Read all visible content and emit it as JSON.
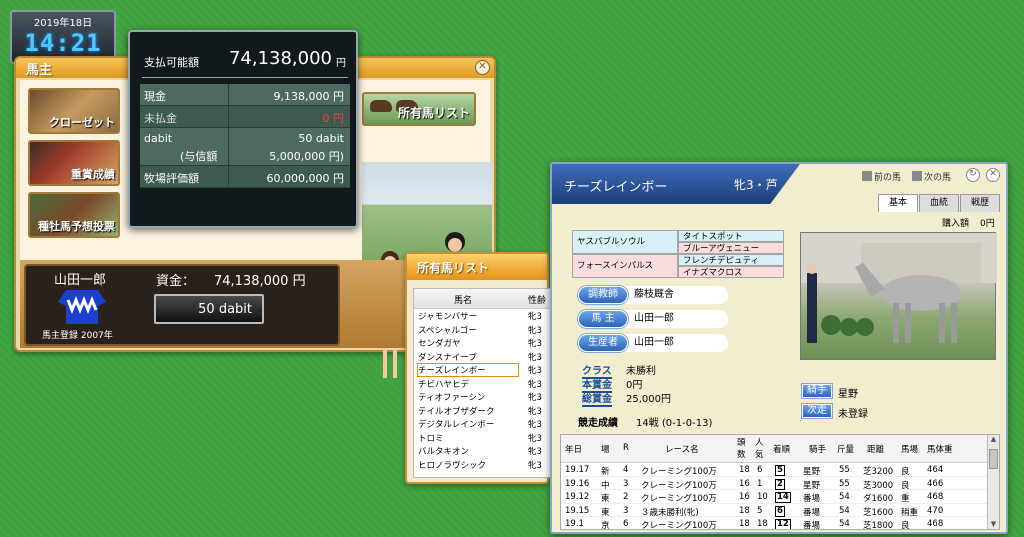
{
  "clock": {
    "date": "2019年18日",
    "time": "14:21"
  },
  "owner_window": {
    "title": "馬主",
    "menu": [
      {
        "label": "クローゼット"
      },
      {
        "label": "重賞成績"
      },
      {
        "label": "種牡馬予想投票"
      }
    ],
    "horse_list_button": "所有馬リスト",
    "owner_name": "山田一郎",
    "registration": "馬主登録 2007年",
    "funds_label": "資金：",
    "funds_value": "74,138,000 円",
    "dabit_button": "50 dabit"
  },
  "payment_popup": {
    "available_label": "支払可能額",
    "available_value": "74,138,000",
    "unit": "円",
    "rows": [
      {
        "key": "現金",
        "value": "9,138,000 円"
      },
      {
        "key": "未払金",
        "value": "0 円"
      },
      {
        "key": "dabit",
        "value": "50 dabit",
        "sub_key": "(与信額",
        "sub_value": "5,000,000 円)"
      },
      {
        "key": "牧場評価額",
        "value": "60,000,000 円"
      }
    ]
  },
  "horse_list": {
    "title": "所有馬リスト",
    "columns": [
      "馬名",
      "性齢"
    ],
    "items": [
      {
        "name": "ジャモンバサー",
        "sex": "牝3"
      },
      {
        "name": "スペシャルゴー",
        "sex": "牝3"
      },
      {
        "name": "センダガヤ",
        "sex": "牝3"
      },
      {
        "name": "ダンスナイーブ",
        "sex": "牝3"
      },
      {
        "name": "チーズレインボー",
        "sex": "牝3"
      },
      {
        "name": "チビハヤヒデ",
        "sex": "牝3"
      },
      {
        "name": "ティオファーシン",
        "sex": "牝3"
      },
      {
        "name": "テイルオブザダーク",
        "sex": "牝3"
      },
      {
        "name": "デジタルレインボー",
        "sex": "牝3"
      },
      {
        "name": "トロミ",
        "sex": "牝3"
      },
      {
        "name": "バルタキオン",
        "sex": "牝3"
      },
      {
        "name": "ヒロノラヴシック",
        "sex": "牝3"
      }
    ],
    "selected": "チーズレインボー"
  },
  "horse_detail": {
    "name": "チーズレインボー",
    "sex_age": "牝3・芦",
    "prev_label": "前の馬",
    "next_label": "次の馬",
    "tabs": [
      "基本",
      "血統",
      "戦歴"
    ],
    "purchase_label": "購入額",
    "purchase_value": "0円",
    "pedigree": {
      "sire": "ヤスパブルソウル",
      "dam": "フォースインパルス",
      "sire_sire": "タイトスポット",
      "sire_dam": "ブルーアヴェニュー",
      "dam_sire": "フレンチデピュティ",
      "dam_dam": "イナズマクロス"
    },
    "info": [
      {
        "label": "調教師",
        "value": "藤枝厩舎"
      },
      {
        "label": "馬 主",
        "value": "山田一郎"
      },
      {
        "label": "生産者",
        "value": "山田一郎"
      }
    ],
    "class_label": "クラス",
    "class_value": "未勝利",
    "prize_label": "本賞金",
    "prize_value": "0円",
    "total_label": "総賞金",
    "total_value": "25,000円",
    "record_label": "競走成績",
    "record_value": "14戦 (0-1-0-13)",
    "jockey_label": "騎手",
    "jockey_value": "星野",
    "next_race_label": "次走",
    "next_race_value": "未登録",
    "race_columns": [
      "年日",
      "場",
      "R",
      "レース名",
      "頭数",
      "人気",
      "着順",
      "騎手",
      "斤量",
      "距離",
      "馬場",
      "馬体重"
    ],
    "races": [
      [
        "19.17",
        "新",
        "4",
        "クレーミング100万",
        "18",
        "6",
        "5",
        "星野",
        "55",
        "芝3200",
        "良",
        "464"
      ],
      [
        "19.16",
        "中",
        "3",
        "クレーミング100万",
        "16",
        "1",
        "2",
        "星野",
        "55",
        "芝3000",
        "良",
        "466"
      ],
      [
        "19.12",
        "東",
        "2",
        "クレーミング100万",
        "16",
        "10",
        "14",
        "番場",
        "54",
        "ダ1600",
        "重",
        "468"
      ],
      [
        "19.15",
        "東",
        "3",
        "３歳未勝利(牝)",
        "18",
        "5",
        "6",
        "番場",
        "54",
        "芝1600",
        "稍重",
        "470"
      ],
      [
        "19.1",
        "京",
        "6",
        "クレーミング100万",
        "18",
        "18",
        "12",
        "番場",
        "54",
        "芝1800",
        "良",
        "468"
      ]
    ]
  }
}
